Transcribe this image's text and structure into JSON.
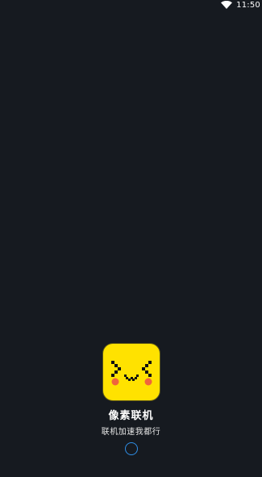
{
  "status_bar": {
    "time": "11:50",
    "icons": [
      "wifi-icon"
    ]
  },
  "splash": {
    "app_name": "像素联机",
    "slogan": "联机加速我都行",
    "icon": "pixel-face-logo",
    "loading_indicator": "spinner-icon"
  },
  "colors": {
    "background": "#161a20",
    "icon_background": "#ffe200",
    "spinner": "#2f8ee6",
    "text": "#ffffff"
  }
}
